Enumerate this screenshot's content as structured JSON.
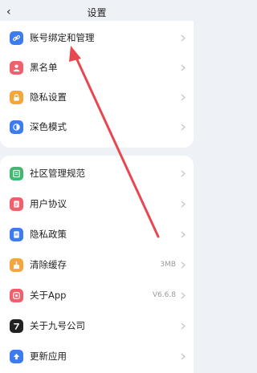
{
  "header": {
    "back_icon": "‹",
    "title": "设置"
  },
  "section1": [
    {
      "label": "账号绑定和管理",
      "icon": "link-icon",
      "color": "#3d7bf0"
    },
    {
      "label": "黑名单",
      "icon": "person-block-icon",
      "color": "#f0606c"
    },
    {
      "label": "隐私设置",
      "icon": "lock-icon",
      "color": "#f5a53a"
    },
    {
      "label": "深色模式",
      "icon": "dark-mode-icon",
      "color": "#3d7bf0"
    }
  ],
  "section2": [
    {
      "label": "社区管理规范",
      "icon": "rules-icon",
      "color": "#3fb871"
    },
    {
      "label": "用户协议",
      "icon": "agreement-icon",
      "color": "#f0606c"
    },
    {
      "label": "隐私政策",
      "icon": "policy-icon",
      "color": "#3d7bf0"
    },
    {
      "label": "清除缓存",
      "icon": "broom-icon",
      "color": "#f5a53a",
      "value": "3MB"
    },
    {
      "label": "关于App",
      "icon": "app-info-icon",
      "color": "#f0606c",
      "value": "V6.6.8"
    },
    {
      "label": "关于九号公司",
      "icon": "ninebot-logo-icon",
      "color": "#222222"
    },
    {
      "label": "更新应用",
      "icon": "update-icon",
      "color": "#3d7bf0"
    }
  ],
  "annotation": {
    "color": "#e8474f"
  }
}
